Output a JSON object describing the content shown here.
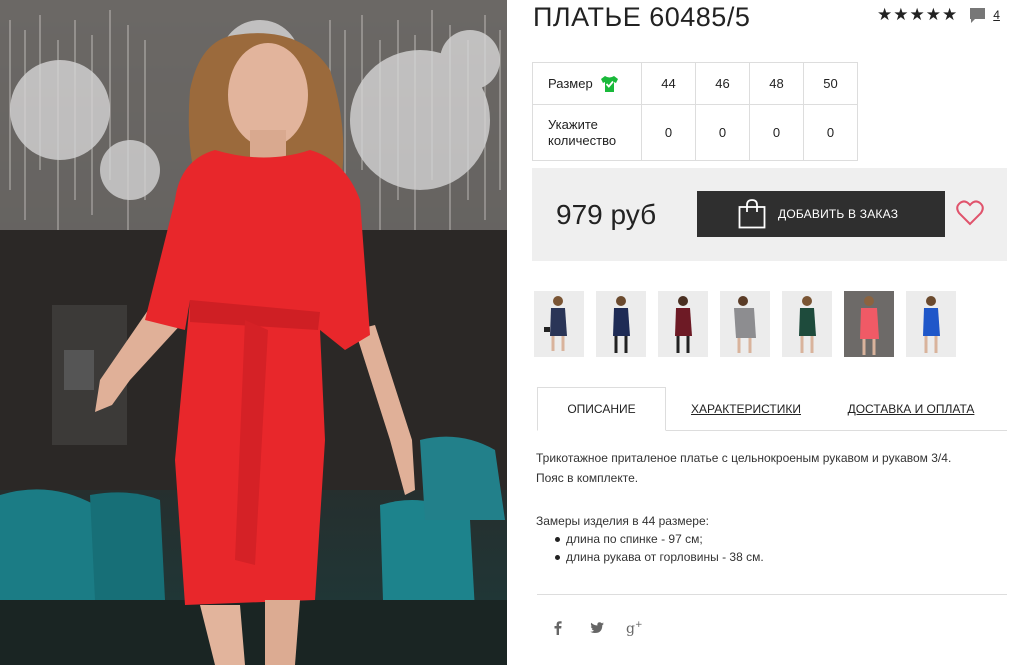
{
  "product": {
    "title": "ПЛАТЬЕ 60485/5",
    "rating_icons": [
      "star-icon",
      "star-icon",
      "star-icon",
      "star-icon",
      "star-icon"
    ],
    "comment_count": "4",
    "price": "979 руб"
  },
  "sizes": {
    "size_label": "Размер",
    "qty_label_line1": "Укажите",
    "qty_label_line2": "количество",
    "values": [
      "44",
      "46",
      "48",
      "50"
    ],
    "quantities": [
      "0",
      "0",
      "0",
      "0"
    ]
  },
  "actions": {
    "order_label": "ДОБАВИТЬ В ЗАКАЗ"
  },
  "tabs": [
    {
      "label": "ОПИСАНИЕ"
    },
    {
      "label": "ХАРАКТЕРИСТИКИ"
    },
    {
      "label": "ДОСТАВКА И ОПЛАТА"
    }
  ],
  "description": {
    "line1": "Трикотажное приталеное платье с цельнокроеным рукавом и рукавом 3/4.",
    "line2": "Пояс в комплекте.",
    "measures_title": "Замеры изделия в 44 размере:",
    "measures": [
      "длина по спинке - 97 см;",
      "длина рукава от горловины - 38 см."
    ]
  },
  "social": [
    "facebook-icon",
    "twitter-icon",
    "google-plus-icon"
  ],
  "colors": {
    "dress_red": "#e8272b",
    "size_icon_green": "#19b93a",
    "button_dark": "#2f2f2f",
    "heart_pink": "#e0536c",
    "price_bar_bg": "#efefef"
  },
  "thumbnails": [
    "navy dress",
    "navy dress",
    "burgundy dress",
    "grey dress",
    "green dress",
    "coral dress",
    "blue dress"
  ]
}
